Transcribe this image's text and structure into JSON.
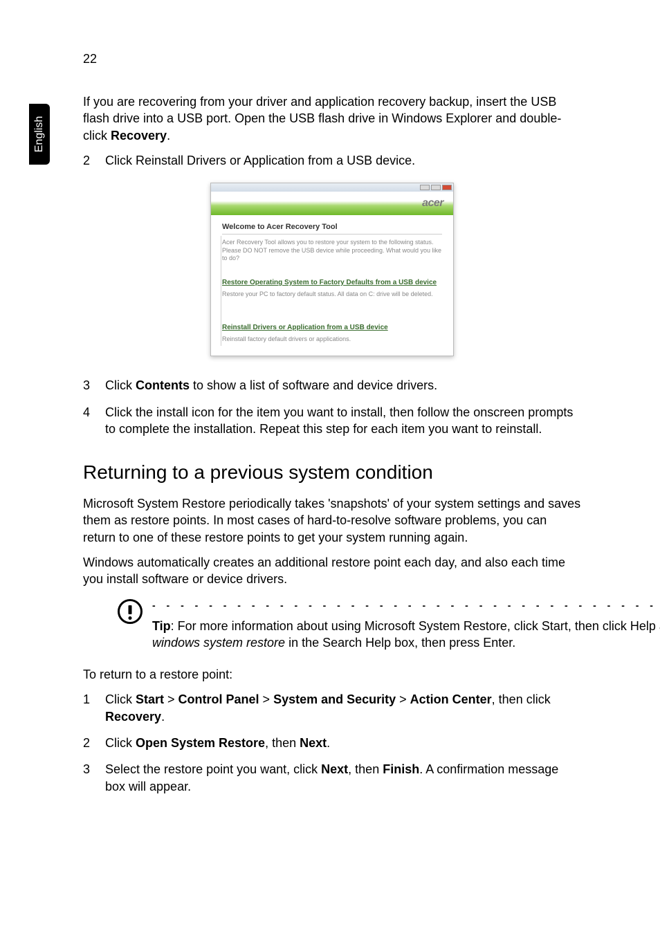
{
  "page_number": "22",
  "sidebar_label": "English",
  "intro_paragraph": {
    "part1": "If you are recovering from your driver and application recovery backup, insert the USB flash drive into a USB port. Open the USB flash drive in Windows Explorer and double-click ",
    "bold": "Recovery",
    "part2": "."
  },
  "step2": {
    "num": "2",
    "text": "Click Reinstall Drivers or Application from a USB device."
  },
  "screenshot": {
    "brand": "acer",
    "title": "Welcome to Acer Recovery Tool",
    "desc": "Acer Recovery Tool allows you to restore your system to the following status. Please DO NOT remove the USB device while proceeding. What would you like to do?",
    "link1": "Restore Operating System to Factory Defaults from a USB device",
    "sub1": "Restore your PC to factory default status. All data on C: drive will be deleted.",
    "link2": "Reinstall Drivers or Application from a USB device",
    "sub2": "Reinstall factory default drivers or applications."
  },
  "step3": {
    "num": "3",
    "pre": "Click ",
    "bold": "Contents",
    "post": " to show a list of software and device drivers."
  },
  "step4": {
    "num": "4",
    "text": "Click the install icon for the item you want to install, then follow the onscreen prompts to complete the installation. Repeat this step for each item you want to reinstall."
  },
  "section_heading": "Returning to a previous system condition",
  "section_para1": "Microsoft System Restore periodically takes 'snapshots' of your system settings and saves them as restore points. In most cases of hard-to-resolve software problems, you can return to one of these restore points to get your system running again.",
  "section_para2": "Windows automatically creates an additional restore point each day, and also each time you install software or device drivers.",
  "tip": {
    "label": "Tip",
    "part1": ": For more information about using Microsoft System Restore, click Start, then click Help and Support. Type ",
    "italic": "windows system restore",
    "part2": " in the Search Help box, then press Enter."
  },
  "return_intro": "To return to a restore point:",
  "ret1": {
    "num": "1",
    "pre": "Click ",
    "b1": "Start ",
    "gt1": " > ",
    "b2": "Control Panel",
    "gt2": " > ",
    "b3": "System and Security",
    "gt3": " > ",
    "b4": "Action Center",
    "mid": ", then click ",
    "b5": "Recovery",
    "post": "."
  },
  "ret2": {
    "num": "2",
    "pre": "Click ",
    "b1": "Open System Restore",
    "mid": ", then ",
    "b2": "Next",
    "post": "."
  },
  "ret3": {
    "num": "3",
    "pre": "Select the restore point you want, click ",
    "b1": "Next",
    "mid": ", then ",
    "b2": "Finish",
    "post": ". A confirmation message box will appear."
  }
}
